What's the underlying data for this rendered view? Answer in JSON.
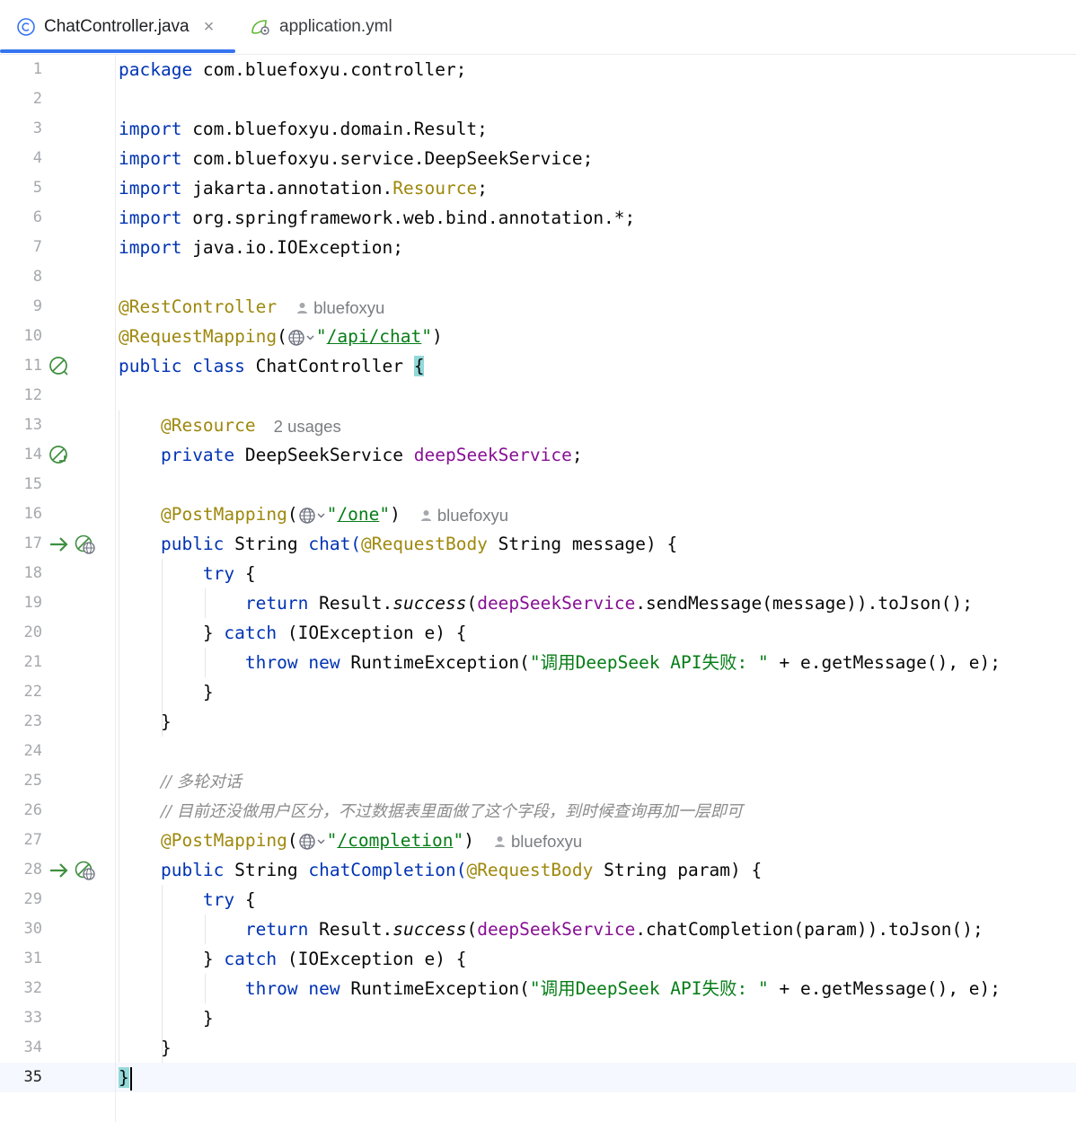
{
  "tabs": [
    {
      "label": "ChatController.java",
      "icon": "class-c-icon",
      "close": "×",
      "active": true
    },
    {
      "label": "application.yml",
      "icon": "spring-leaf-config-icon",
      "active": false
    }
  ],
  "colors": {
    "keyword": "#0033b3",
    "annotation": "#9e880d",
    "string": "#067d17",
    "field": "#871094",
    "comment": "#8c8c8c",
    "accent": "#3574f0"
  },
  "hints": {
    "author": "bluefoxyu",
    "usages": "2 usages"
  },
  "code": {
    "l1_kw": "package",
    "l1_rest": " com.bluefoxyu.controller;",
    "import_kw": "import",
    "l3_rest": " com.bluefoxyu.domain.Result;",
    "l4_rest": " com.bluefoxyu.service.DeepSeekService;",
    "l5_pre": " jakarta.annotation.",
    "l5_ann": "Resource",
    "l5_post": ";",
    "l6_rest": " org.springframework.web.bind.annotation.*;",
    "l7_rest": " java.io.IOException;",
    "l9_ann": "@RestController",
    "l10_ann": "@RequestMapping",
    "l10_path": "/api/chat",
    "l11_kw": "public class",
    "l11_name": " ChatController ",
    "open_brace": "{",
    "l13_ann": "@Resource",
    "l14_kw": "private",
    "l14_type": " DeepSeekService ",
    "l14_field": "deepSeekService",
    "semi": ";",
    "post_ann": "@PostMapping",
    "l16_path": "/one",
    "public_kw": "public",
    "string_type": " String ",
    "l17_method": "chat(",
    "reqbody": "@RequestBody",
    "l17_rest": " String message) {",
    "try_kw": "try",
    "brace_open_sp": " {",
    "return_kw": "return",
    "result_cls": " Result.",
    "success": "success",
    "paren_open": "(",
    "field_ref": "deepSeekService",
    "l19_call": ".sendMessage(message)).toJson();",
    "close_brace": "}",
    "catch_kw": "catch",
    "catch_rest": " (IOException e) {",
    "throw_kw": "throw",
    "new_kw": "new",
    "rte": " RuntimeException(",
    "err_str": "\"调用DeepSeek API失败: \"",
    "err_rest": " + e.getMessage(), e);",
    "l25_cmt": "// 多轮对话",
    "l26_cmt": "// 目前还没做用户区分，不过数据表里面做了这个字段，到时候查询再加一层即可",
    "l27_path": "/completion",
    "l28_method": "chatCompletion(",
    "l28_rest": " String param) {",
    "l30_call": ".chatCompletion(param)).toJson();",
    "final_brace": "}"
  },
  "line_numbers": [
    "1",
    "2",
    "3",
    "4",
    "5",
    "6",
    "7",
    "8",
    "9",
    "10",
    "11",
    "12",
    "13",
    "14",
    "15",
    "16",
    "17",
    "18",
    "19",
    "20",
    "21",
    "22",
    "23",
    "24",
    "25",
    "26",
    "27",
    "28",
    "29",
    "30",
    "31",
    "32",
    "33",
    "34",
    "35"
  ]
}
